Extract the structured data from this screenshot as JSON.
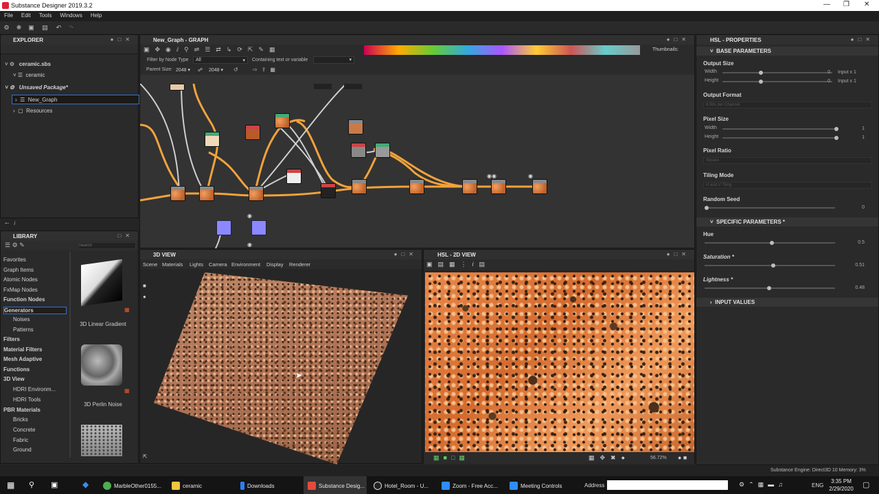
{
  "app_title": "Substance Designer 2019.3.2",
  "menu": [
    "File",
    "Edit",
    "Tools",
    "Windows",
    "Help"
  ],
  "explorer": {
    "title": "EXPLORER",
    "items": [
      {
        "label": "ceramic.sbs"
      },
      {
        "label": "ceramic"
      },
      {
        "label": "Unsaved Package*"
      },
      {
        "label": "New_Graph"
      },
      {
        "label": "Resources"
      }
    ]
  },
  "graph": {
    "title": "New_Graph - GRAPH",
    "filter_label": "Filter by Node Type",
    "filter_value": "All",
    "containing_label": "Containing text or variable",
    "thumbnails_label": "Thumbnails:",
    "parent_size_label": "Parent Size:",
    "parent_w": "2048",
    "parent_h": "2048"
  },
  "library": {
    "title": "LIBRARY",
    "search_placeholder": "Search",
    "categories": [
      {
        "label": "Favorites",
        "bold": false
      },
      {
        "label": "Graph Items",
        "bold": false
      },
      {
        "label": "Atomic Nodes",
        "bold": false
      },
      {
        "label": "FxMap Nodes",
        "bold": false
      },
      {
        "label": "Function Nodes",
        "bold": true
      },
      {
        "label": "Generators",
        "bold": true
      },
      {
        "label": "Noises",
        "bold": false
      },
      {
        "label": "Patterns",
        "bold": false
      },
      {
        "label": "Filters",
        "bold": true
      },
      {
        "label": "Material Filters",
        "bold": true
      },
      {
        "label": "Mesh Adaptive",
        "bold": true
      },
      {
        "label": "Functions",
        "bold": true
      },
      {
        "label": "3D View",
        "bold": true
      },
      {
        "label": "HDRI Environm...",
        "bold": false
      },
      {
        "label": "HDRI Tools",
        "bold": false
      },
      {
        "label": "PBR Materials",
        "bold": true
      },
      {
        "label": "Bricks",
        "bold": false
      },
      {
        "label": "Concrete",
        "bold": false
      },
      {
        "label": "Fabric",
        "bold": false
      },
      {
        "label": "Ground",
        "bold": false
      }
    ],
    "thumbs": [
      {
        "label": "3D Linear Gradient"
      },
      {
        "label": "3D Perlin Noise"
      }
    ]
  },
  "view3d": {
    "title": "3D VIEW",
    "menu": [
      "Scene",
      "Materials",
      "Lights",
      "Camera",
      "Environment",
      "Display",
      "Renderer"
    ]
  },
  "view2d": {
    "title": "HSL - 2D VIEW",
    "zoom": "56.72%"
  },
  "properties": {
    "title": "HSL - PROPERTIES",
    "base_section": "BASE PARAMETERS",
    "output_size": "Output Size",
    "width": "Width",
    "height": "Height",
    "os_w_val": "0",
    "os_h_val": "0",
    "os_w_mode": "Input x 1",
    "os_h_mode": "Input x 1",
    "output_format": "Output Format",
    "output_format_value": "8 Bits per Channel",
    "pixel_size": "Pixel Size",
    "ps_w_val": "1",
    "ps_h_val": "1",
    "pixel_ratio": "Pixel Ratio",
    "pixel_ratio_value": "Square",
    "tiling_mode": "Tiling Mode",
    "tiling_mode_value": "H and V Tiling",
    "random_seed": "Random Seed",
    "random_seed_val": "0",
    "specific_section": "SPECIFIC PARAMETERS *",
    "hue": "Hue",
    "hue_val": "0.5",
    "saturation": "Saturation *",
    "saturation_val": "0.51",
    "lightness": "Lightness *",
    "lightness_val": "0.48",
    "input_section": "INPUT VALUES"
  },
  "status": "Substance Engine: Direct3D 10  Memory: 3%",
  "taskbar": {
    "items": [
      "MarbleOther0155...",
      "ceramic",
      "Downloads",
      "Substance Desig...",
      "Hotel_Room - U...",
      "Zoom - Free Acc...",
      "Meeting Controls"
    ],
    "address_label": "Address",
    "lang": "ENG",
    "time": "3:35 PM",
    "date": "2/29/2020"
  }
}
